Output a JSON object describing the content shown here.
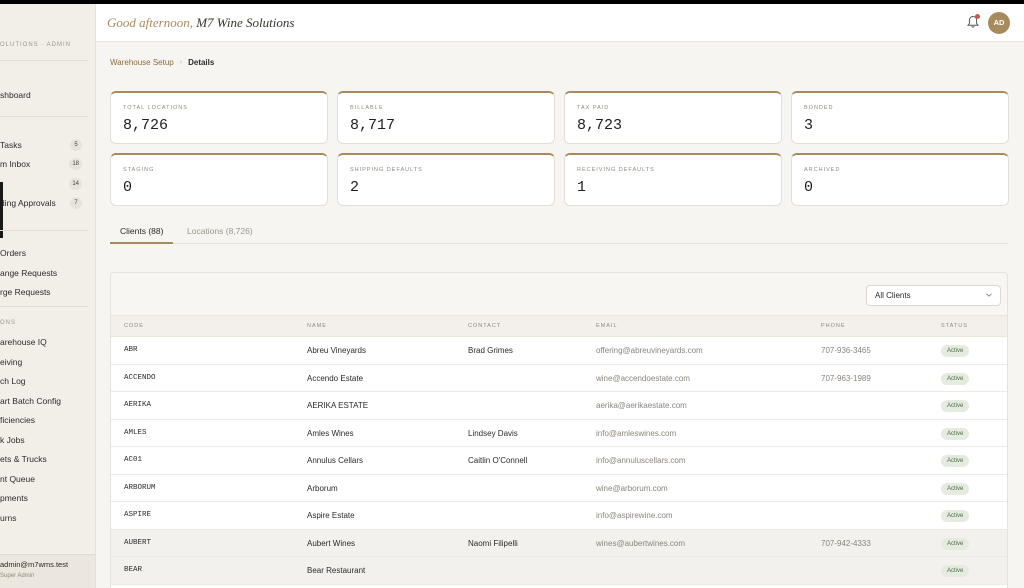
{
  "colors": {
    "accent": "#a88b5c",
    "status_active_bg": "#e6ebe2",
    "status_active_text": "#4b6a3f",
    "notification_dot": "#d4534a"
  },
  "sidebar": {
    "brand": "OLUTIONS · ADMIN",
    "items": [
      {
        "label": "shboard",
        "badge": ""
      },
      {
        "label": "Tasks",
        "badge": "5"
      },
      {
        "label": "m Inbox",
        "badge": "18"
      },
      {
        "label": "",
        "badge": "14"
      },
      {
        "label": "ding Approvals",
        "badge": "7"
      },
      {
        "label": "Orders",
        "badge": ""
      },
      {
        "label": "ange Requests",
        "badge": ""
      },
      {
        "label": "rge Requests",
        "badge": ""
      }
    ],
    "section_label": "ONS",
    "ops_items": [
      "arehouse IQ",
      "eiving",
      "ch Log",
      "art Batch Config",
      "ficiencies",
      "k Jobs",
      "ets & Trucks",
      "nt Queue",
      "pments",
      "urns"
    ],
    "user": {
      "email": "admin@m7wms.test",
      "role": "Super Admin"
    }
  },
  "header": {
    "greeting_prefix": "Good afternoon,",
    "greeting_name": "M7 Wine Solutions",
    "avatar_initials": "AD",
    "bell_icon": "bell-icon"
  },
  "breadcrumb": {
    "parent": "Warehouse Setup",
    "separator": "›",
    "current": "Details"
  },
  "stats": [
    {
      "label": "TOTAL LOCATIONS",
      "value": "8,726"
    },
    {
      "label": "BILLABLE",
      "value": "8,717"
    },
    {
      "label": "TAX PAID",
      "value": "8,723"
    },
    {
      "label": "BONDED",
      "value": "3"
    },
    {
      "label": "STAGING",
      "value": "0"
    },
    {
      "label": "SHIPPING DEFAULTS",
      "value": "2"
    },
    {
      "label": "RECEIVING DEFAULTS",
      "value": "1"
    },
    {
      "label": "ARCHIVED",
      "value": "0"
    }
  ],
  "tabs": [
    {
      "label": "Clients (88)",
      "active": true
    },
    {
      "label": "Locations (8,726)",
      "active": false
    }
  ],
  "filter": {
    "selected": "All Clients"
  },
  "table": {
    "columns": [
      "CODE",
      "NAME",
      "CONTACT",
      "EMAIL",
      "PHONE",
      "STATUS"
    ],
    "rows": [
      {
        "code": "ABR",
        "name": "Abreu Vineyards",
        "contact": "Brad Grimes",
        "email": "offering@abreuvineyards.com",
        "phone": "707-936-3465",
        "status": "Active"
      },
      {
        "code": "ACCENDO",
        "name": "Accendo Estate",
        "contact": "",
        "email": "wine@accendoestate.com",
        "phone": "707-963-1989",
        "status": "Active"
      },
      {
        "code": "AERIKA",
        "name": "AERIKA ESTATE",
        "contact": "",
        "email": "aerika@aerikaestate.com",
        "phone": "",
        "status": "Active"
      },
      {
        "code": "AMLES",
        "name": "Amles Wines",
        "contact": "Lindsey Davis",
        "email": "info@amleswines.com",
        "phone": "",
        "status": "Active"
      },
      {
        "code": "AC01",
        "name": "Annulus Cellars",
        "contact": "Caitlin O'Connell",
        "email": "info@annuluscellars.com",
        "phone": "",
        "status": "Active"
      },
      {
        "code": "ARBORUM",
        "name": "Arborum",
        "contact": "",
        "email": "wine@arborum.com",
        "phone": "",
        "status": "Active"
      },
      {
        "code": "ASPIRE",
        "name": "Aspire Estate",
        "contact": "",
        "email": "info@aspirewine.com",
        "phone": "",
        "status": "Active"
      },
      {
        "code": "AUBERT",
        "name": "Aubert Wines",
        "contact": "Naomi Filipelli",
        "email": "wines@aubertwines.com",
        "phone": "707-942-4333",
        "status": "Active"
      },
      {
        "code": "BEAR",
        "name": "Bear Restaurant",
        "contact": "",
        "email": "",
        "phone": "",
        "status": "Active"
      }
    ]
  }
}
